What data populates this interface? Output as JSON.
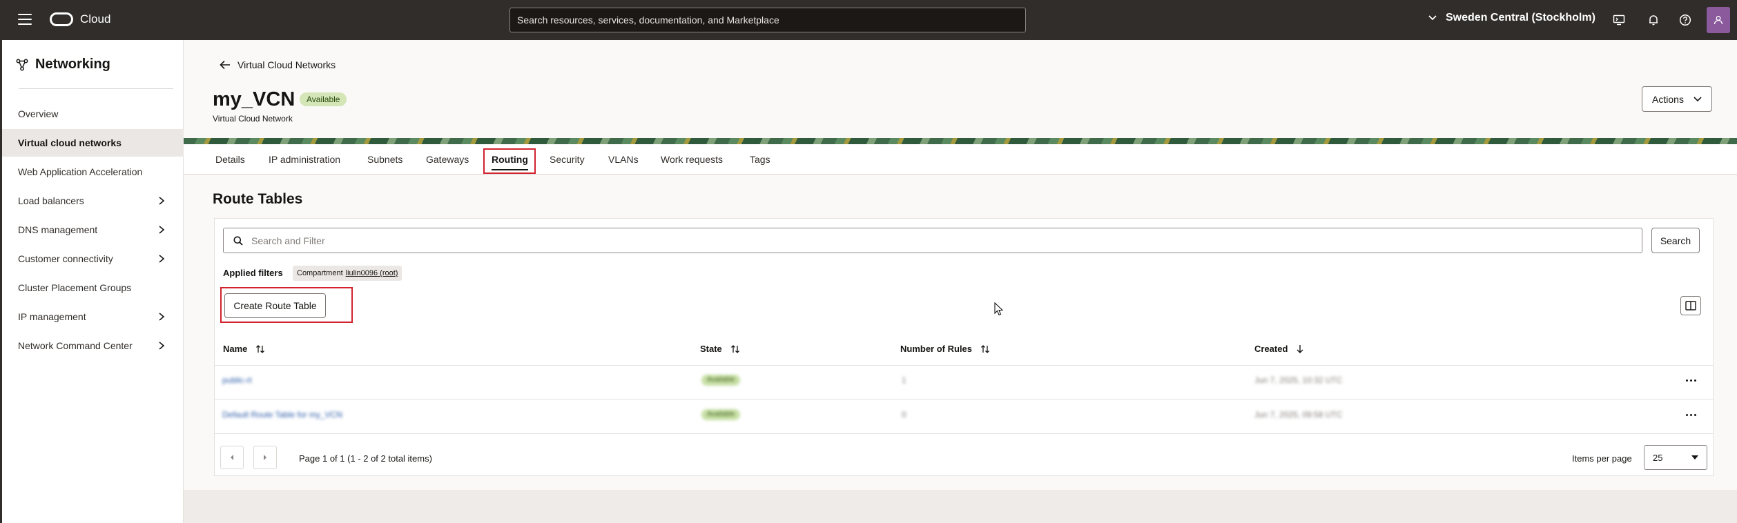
{
  "header": {
    "brand": "Cloud",
    "search_placeholder": "Search resources, services, documentation, and Marketplace",
    "region": "Sweden Central (Stockholm)"
  },
  "sidebar": {
    "title": "Networking",
    "items": [
      {
        "label": "Overview",
        "active": false,
        "has_submenu": false
      },
      {
        "label": "Virtual cloud networks",
        "active": true,
        "has_submenu": false
      },
      {
        "label": "Web Application Acceleration",
        "active": false,
        "has_submenu": false
      },
      {
        "label": "Load balancers",
        "active": false,
        "has_submenu": true
      },
      {
        "label": "DNS management",
        "active": false,
        "has_submenu": true
      },
      {
        "label": "Customer connectivity",
        "active": false,
        "has_submenu": true
      },
      {
        "label": "Cluster Placement Groups",
        "active": false,
        "has_submenu": false
      },
      {
        "label": "IP management",
        "active": false,
        "has_submenu": true
      },
      {
        "label": "Network Command Center",
        "active": false,
        "has_submenu": true
      }
    ]
  },
  "page": {
    "back_label": "Virtual Cloud Networks",
    "title": "my_VCN",
    "status": "Available",
    "subtitle": "Virtual Cloud Network",
    "actions_label": "Actions"
  },
  "tabs": [
    {
      "label": "Details"
    },
    {
      "label": "IP administration"
    },
    {
      "label": "Subnets"
    },
    {
      "label": "Gateways"
    },
    {
      "label": "Routing"
    },
    {
      "label": "Security"
    },
    {
      "label": "VLANs"
    },
    {
      "label": "Work requests"
    },
    {
      "label": "Tags"
    }
  ],
  "active_tab": "Routing",
  "route_tables": {
    "section_title": "Route Tables",
    "filter_placeholder": "Search and Filter",
    "search_label": "Search",
    "applied_filters_label": "Applied filters",
    "filter_chip": {
      "key": "Compartment",
      "value": "liulin0096 (root)"
    },
    "create_label": "Create Route Table",
    "columns": [
      "Name",
      "State",
      "Number of Rules",
      "Created"
    ],
    "rows": [
      {
        "name": "public-rt",
        "state": "Available",
        "rules": "1",
        "created": "Jun 7, 2025, 10:32 UTC"
      },
      {
        "name": "Default Route Table for my_VCN",
        "state": "Available",
        "rules": "0",
        "created": "Jun 7, 2025, 09:58 UTC"
      }
    ],
    "pagination_text": "Page 1 of 1 (1 - 2 of 2 total items)",
    "items_per_page_label": "Items per page",
    "items_per_page_value": "25"
  },
  "colors": {
    "topbar": "#312d2a",
    "highlight": "#d1222d",
    "badge": "#d4e6b7",
    "avatar": "#8a5a9d"
  }
}
